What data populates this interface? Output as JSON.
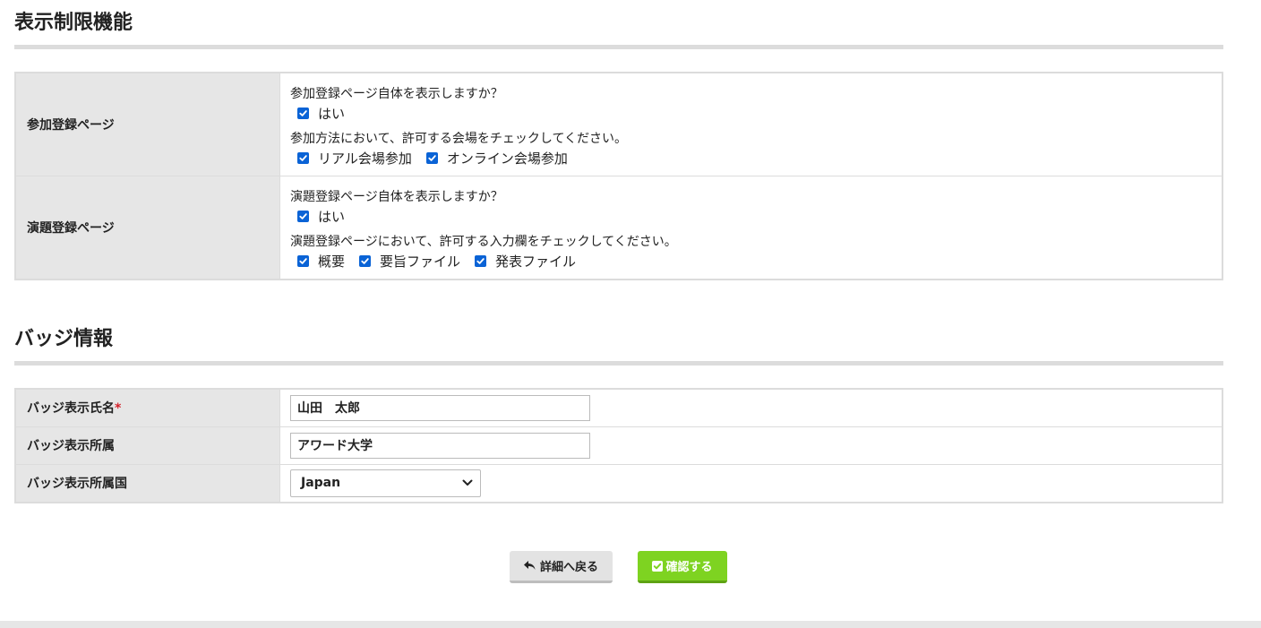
{
  "display_restriction": {
    "title": "表示制限機能",
    "rows": [
      {
        "label": "参加登録ページ",
        "question1": "参加登録ページ自体を表示しますか？",
        "option_yes": "はい",
        "question2": "参加方法において、許可する会場をチェックしてください。",
        "options": [
          "リアル会場参加",
          "オンライン会場参加"
        ]
      },
      {
        "label": "演題登録ページ",
        "question1": "演題登録ページ自体を表示しますか？",
        "option_yes": "はい",
        "question2": "演題登録ページにおいて、許可する入力欄をチェックしてください。",
        "options": [
          "概要",
          "要旨ファイル",
          "発表ファイル"
        ]
      }
    ]
  },
  "badge_info": {
    "title": "バッジ情報",
    "name_label": "バッジ表示氏名",
    "required_mark": "*",
    "name_value": "山田　太郎",
    "affiliation_label": "バッジ表示所属",
    "affiliation_value": "アワード大学",
    "country_label": "バッジ表示所属国",
    "country_value": "Japan"
  },
  "actions": {
    "back_label": "詳細へ戻る",
    "confirm_label": "確認する"
  },
  "colors": {
    "checkbox": "#0a63d6",
    "confirm_button": "#7ed321",
    "back_button": "#e3e3e3",
    "required": "#d4212a"
  },
  "icons": {
    "back": "reply-arrow-icon",
    "confirm": "check-square-icon",
    "select": "chevron-down-icon"
  }
}
